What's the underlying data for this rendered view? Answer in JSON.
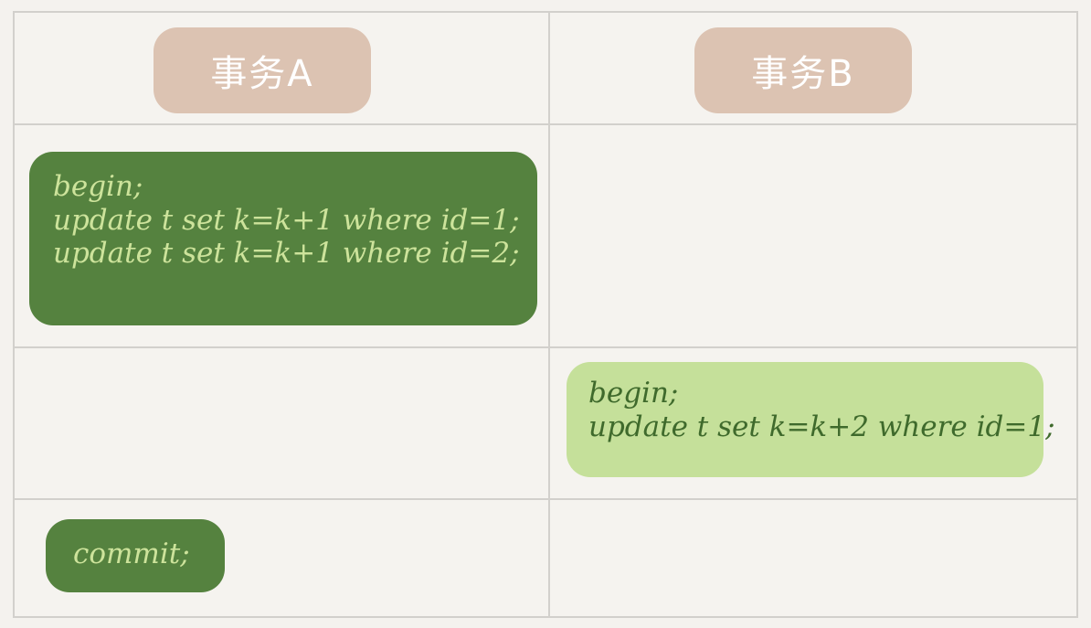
{
  "header": {
    "col_a": "事务A",
    "col_b": "事务B"
  },
  "steps": {
    "a1": [
      "begin;",
      "update t set k=k+1 where id=1;",
      "update t set k=k+1 where id=2;"
    ],
    "b1": [
      "begin;",
      "update t set k=k+2 where id=1;"
    ],
    "a2": [
      "commit;"
    ]
  },
  "colors": {
    "header_pill": "#dcc3b2",
    "dark_block": "#55823f",
    "dark_text": "#cde39b",
    "light_block": "#c5e09a",
    "light_text": "#3f6a2c",
    "grid_line": "#d2d0cc"
  }
}
